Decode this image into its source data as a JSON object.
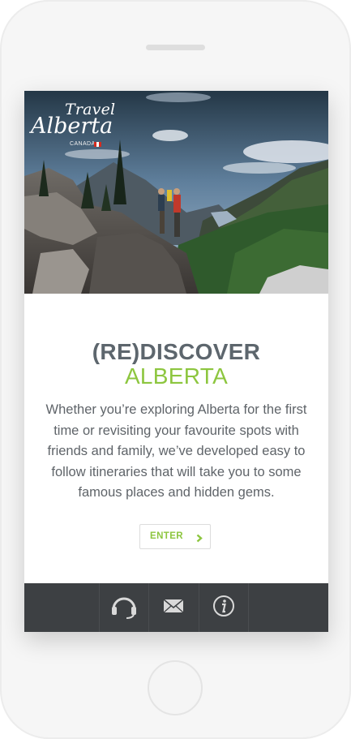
{
  "brand": {
    "logo_line1": "Travel",
    "logo_line2": "Alberta",
    "logo_line3": "CANADA"
  },
  "hero": {
    "image": "two hikers on a rocky ledge overlooking a mountain valley"
  },
  "main": {
    "title_line1": "(RE)DISCOVER",
    "title_line2": "ALBERTA",
    "description": "Whether you’re exploring Alberta for the first time or revisiting your favourite spots with friends and family, we’ve developed easy to follow itineraries that will take you to some famous places and hidden gems.",
    "enter_label": "ENTER"
  },
  "toolbar": {
    "items": [
      {
        "icon": "headset-icon"
      },
      {
        "icon": "mail-icon"
      },
      {
        "icon": "info-icon"
      }
    ]
  },
  "colors": {
    "accent": "#8dc63f",
    "title_gray": "#5d666d",
    "toolbar_bg": "#3d4043"
  }
}
